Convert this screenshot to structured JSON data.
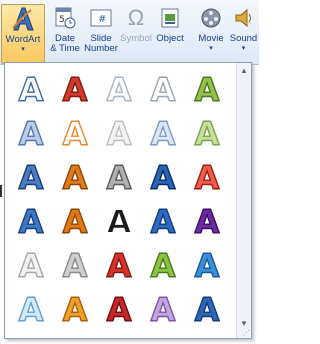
{
  "ribbon": {
    "buttons": [
      {
        "label": "WordArt",
        "icon": "wordart-icon",
        "active": true
      },
      {
        "label": "Date & Time",
        "icon": "calendar-clock-icon"
      },
      {
        "label": "Slide Number",
        "icon": "slide-number-icon"
      },
      {
        "label": "Symbol",
        "icon": "omega-icon",
        "disabled": true
      },
      {
        "label": "Object",
        "icon": "object-icon"
      },
      {
        "label": "Movie",
        "icon": "film-reel-icon"
      },
      {
        "label": "Sound",
        "icon": "speaker-icon"
      }
    ],
    "wordart_label": "WordArt",
    "date_label_1": "Date",
    "date_label_2": "& Time",
    "slide_label_1": "Slide",
    "slide_label_2": "Number",
    "symbol_label": "Symbol",
    "object_label": "Object",
    "movie_label": "Movie",
    "sound_label": "Sound",
    "slide_icon_text": "#"
  },
  "gallery": {
    "glyph": "A",
    "styles": [
      [
        "#ffffff|#3e6ea8",
        "#d23a2c|#7d1d14",
        "#ffffff|#a8b6c8",
        "#ffffff|#9aa6b6",
        "#92c24a|#4d7a20"
      ],
      [
        "#b9cce4|#4f7ab3",
        "#ffffff|#e5892c",
        "#f3f3f3|#c0c0c0",
        "#dbe6f3|#7a9cc8",
        "#c6df9c|#7ea24c"
      ],
      [
        "#4a7cc0|#1b3f78",
        "#e37a18|#8d4508",
        "#b0b0b0|#5a5a5a",
        "#2a62b4|#0e2f66",
        "#f05a4d|#9b1f16"
      ],
      [
        "#3a78c8|#1b3f78",
        "#e07b14|#8d4508",
        "#1a1a1a|#ffffff",
        "#2c6bc0|#143c7c",
        "#6a2aa0|#3b1060"
      ],
      [
        "#f2f2f2|#a8a8a8",
        "#cfcfcf|#8a8a8a",
        "#d8312a|#7d1d14",
        "#8bc440|#4d7a20",
        "#3a90d8|#1b5a98"
      ],
      [
        "#d6e9f8|#5aa0d8",
        "#f0a028|#a8620a",
        "#c8262a|#6d0f12",
        "#c2a6dc|#7b55a8",
        "#2f67b4|#123c7c"
      ]
    ]
  },
  "colors": {
    "accent": "#15428b",
    "active_bg": "#fbc95f"
  }
}
